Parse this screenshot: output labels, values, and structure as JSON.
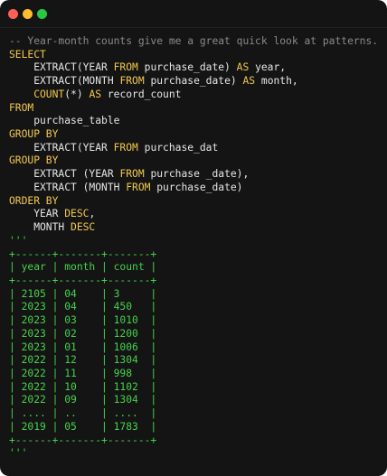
{
  "window": {
    "buttons": [
      "close",
      "minimize",
      "zoom"
    ]
  },
  "colors": {
    "background": "#141414",
    "keyword": "#f2c94c",
    "text": "#e6e6e6",
    "comment": "#8a8a8a",
    "output": "#45d24a"
  },
  "code": {
    "comment": "-- Year-month counts give me a great quick look at patterns.",
    "select": "SELECT",
    "line_year": {
      "a": "    EXTRACT(YEAR ",
      "from": "FROM",
      "b": " purchase_date) ",
      "as": "AS",
      "c": " year,"
    },
    "line_month": {
      "a": "    EXTRACT(MONTH ",
      "from": "FROM",
      "b": " purchase_date) ",
      "as": "AS",
      "c": " month,"
    },
    "line_count": {
      "fn": "    COUNT",
      "a": "(*) ",
      "as": "AS",
      "c": " record_count"
    },
    "from": "FROM",
    "table": "    purchase_table",
    "group_by_1": "GROUP BY",
    "gb1_line": {
      "a": "    EXTRACT(YEAR ",
      "from": "FROM",
      "b": " purchase_dat"
    },
    "group_by_2": "GROUP BY",
    "gb2_line1": {
      "a": "    EXTRACT (YEAR ",
      "from": "FROM",
      "b": " purchase _date),"
    },
    "gb2_line2": {
      "a": "    EXTRACT (MONTH ",
      "from": "FROM",
      "b": " purchase_date)"
    },
    "order_by": "ORDER BY",
    "ob_line1": {
      "a": "    YEAR ",
      "kw": "DESC",
      "b": ","
    },
    "ob_line2": {
      "a": "    MONTH ",
      "kw": "DESC"
    },
    "fence_close": "'''"
  },
  "output": {
    "border": "+------+-------+-------+",
    "header": "| year | month | count |",
    "rows": [
      "| 2105 | 04    | 3     |",
      "| 2023 | 04    | 450   |",
      "| 2023 | 03    | 1010  |",
      "| 2023 | 02    | 1200  |",
      "| 2023 | 01    | 1006  |",
      "| 2022 | 12    | 1304  |",
      "| 2022 | 11    | 998   |",
      "| 2022 | 10    | 1102  |",
      "| 2022 | 09    | 1304  |",
      "| .... | ..    | ....  |",
      "| 2019 | 05    | 1783  |"
    ],
    "fence_close": "'''"
  }
}
